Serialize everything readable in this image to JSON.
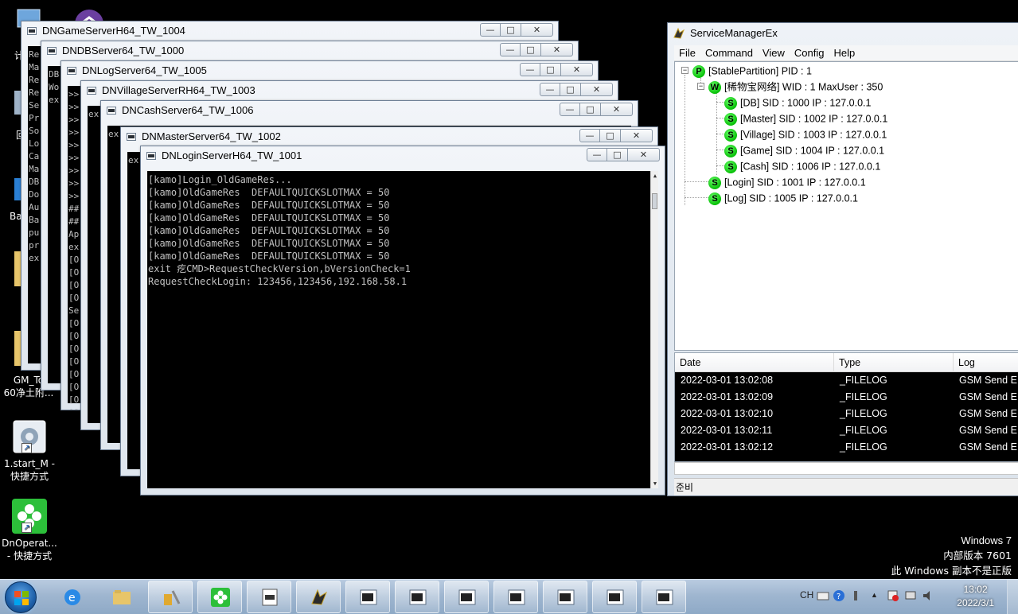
{
  "desktop": {
    "icons": [
      {
        "label": "GM_To 60净土附...",
        "line1": "GM_To",
        "line2": "60净土附..."
      },
      {
        "label": "1.start_M - 快捷方式",
        "line1": "1.start_M -",
        "line2": "快捷方式"
      },
      {
        "label": "DnOperat... - 快捷方式",
        "line1": "DnOperat...",
        "line2": "- 快捷方式"
      }
    ],
    "partial_labels": [
      "计",
      "回",
      "Ba"
    ]
  },
  "windows": {
    "game": {
      "title": "DNGameServerH64_TW_1004",
      "peek": "Re\nMa\nRe\nRe\nSe\nPr\nSo\nLo\nCa\nMa\nDB\nDo\nAu\nBa\npu\npr\nex"
    },
    "db": {
      "title": "DNDBServer64_TW_1000",
      "peek": "DB\nWo\nex"
    },
    "log": {
      "title": "DNLogServer64_TW_1005",
      "peek": ">>\n>>\n>>\n>>\n>>\n>>\n>>\n>>\n>>\n##\n##\nAp\nex\n[O\n[O\n[O\n[O\nSe\n[O\n[O\n[O\n[O\n[O\n[O\n[O\n[O"
    },
    "village": {
      "title": "DNVillageServerRH64_TW_1003",
      "peek": "ex"
    },
    "cash": {
      "title": "DNCashServer64_TW_1006",
      "peek": "ex"
    },
    "master": {
      "title": "DNMasterServer64_TW_1002",
      "peek": "ex"
    },
    "login": {
      "title": "DNLoginServerH64_TW_1001",
      "lines": [
        "[kamo]Login_OldGameRes...",
        "[kamo]OldGameRes  DEFAULTQUICKSLOTMAX = 50",
        "[kamo]OldGameRes  DEFAULTQUICKSLOTMAX = 50",
        "[kamo]OldGameRes  DEFAULTQUICKSLOTMAX = 50",
        "[kamo]OldGameRes  DEFAULTQUICKSLOTMAX = 50",
        "[kamo]OldGameRes  DEFAULTQUICKSLOTMAX = 50",
        "[kamo]OldGameRes  DEFAULTQUICKSLOTMAX = 50",
        "exit 疙CMD>RequestCheckVersion,bVersionCheck=1",
        "RequestCheckLogin: 123456,123456,192.168.58.1"
      ]
    }
  },
  "window_controls": {
    "minimize": "—",
    "maximize": "□",
    "close": "✕"
  },
  "service_manager": {
    "title": "ServiceManagerEx",
    "menu": [
      "File",
      "Command",
      "View",
      "Config",
      "Help"
    ],
    "tree": [
      {
        "badge": "P",
        "label": "[StablePartition] PID : 1"
      },
      {
        "badge": "W",
        "label": "[稀物宝网络] WID : 1 MaxUser : 350"
      },
      {
        "badge": "S",
        "label": "[DB] SID : 1000 IP : 127.0.0.1"
      },
      {
        "badge": "S",
        "label": "[Master] SID : 1002 IP : 127.0.0.1"
      },
      {
        "badge": "S",
        "label": "[Village] SID : 1003 IP : 127.0.0.1"
      },
      {
        "badge": "S",
        "label": "[Game] SID : 1004 IP : 127.0.0.1"
      },
      {
        "badge": "S",
        "label": "[Cash] SID : 1006 IP : 127.0.0.1"
      },
      {
        "badge": "S",
        "label": "[Login] SID : 1001 IP : 127.0.0.1"
      },
      {
        "badge": "S",
        "label": "[Log] SID : 1005 IP : 127.0.0.1"
      }
    ],
    "log_columns": [
      "Date",
      "Type",
      "Log"
    ],
    "log_rows": [
      {
        "date": "2022-03-01 13:02:08",
        "type": "_FILELOG",
        "log": "GSM Send E"
      },
      {
        "date": "2022-03-01 13:02:09",
        "type": "_FILELOG",
        "log": "GSM Send E"
      },
      {
        "date": "2022-03-01 13:02:10",
        "type": "_FILELOG",
        "log": "GSM Send E"
      },
      {
        "date": "2022-03-01 13:02:11",
        "type": "_FILELOG",
        "log": "GSM Send E"
      },
      {
        "date": "2022-03-01 13:02:12",
        "type": "_FILELOG",
        "log": "GSM Send E"
      }
    ],
    "status": "준비"
  },
  "watermark": {
    "line1": "Windows 7",
    "line2": "内部版本 7601",
    "line3": "此 Windows 副本不是正版"
  },
  "taskbar": {
    "apps": [
      "ie-icon",
      "explorer-icon",
      "tools-icon",
      "clover-icon",
      "notepad-icon",
      "dragon-icon",
      "console-icon",
      "console-icon",
      "console-icon",
      "console-icon",
      "console-icon",
      "console-icon",
      "console-icon"
    ],
    "tray": {
      "lang": "CH"
    },
    "clock": {
      "time": "13:02",
      "date": "2022/3/1"
    }
  },
  "colors": {
    "badge_green": "#08c008",
    "console_text": "#c0c0c0",
    "taskbar": "#a9bfd7"
  }
}
